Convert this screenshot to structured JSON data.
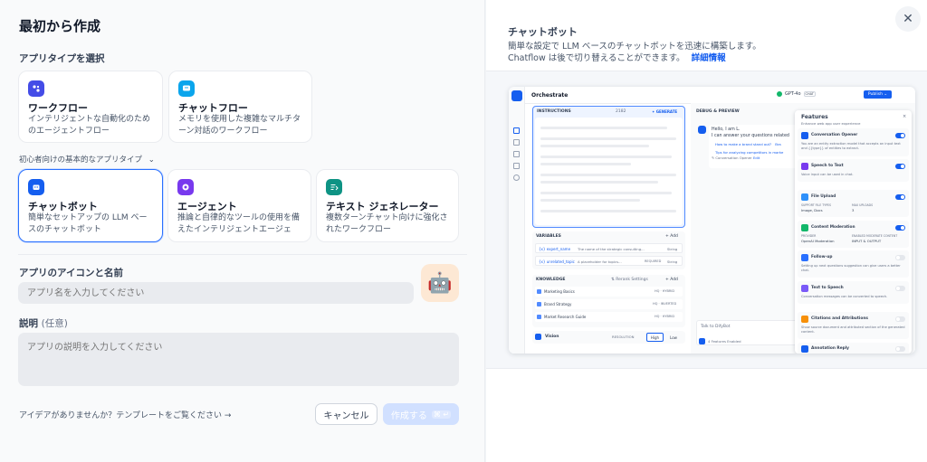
{
  "dialog": {
    "title": "最初から作成",
    "select_type_label": "アプリタイプを選択",
    "beginner_label": "初心者向けの基本的なアプリタイプ",
    "app_types_row1": [
      {
        "name": "ワークフロー",
        "desc": "インテリジェントな自動化のためのエージェントフロー"
      },
      {
        "name": "チャットフロー",
        "desc": "メモリを使用した複雑なマルチターン対話のワークフロー"
      }
    ],
    "app_types_row2": [
      {
        "name": "チャットボット",
        "desc": "簡単なセットアップの LLM ベースのチャットボット"
      },
      {
        "name": "エージェント",
        "desc": "推論と自律的なツールの使用を備えたインテリジェントエージェン…"
      },
      {
        "name": "テキスト ジェネレーター",
        "desc": "複数ターンチャット向けに強化されたワークフロー"
      }
    ],
    "icon_name_label": "アプリのアイコンと名前",
    "name_placeholder": "アプリ名を入力してください",
    "description_label": "説明",
    "description_optional": "(任意)",
    "description_placeholder": "アプリの説明を入力してください",
    "template_link": "アイデアがありませんか？テンプレートをご覧ください →",
    "cancel_label": "キャンセル",
    "create_label": "作成する",
    "create_shortcut": "⌘ ↵",
    "app_icon_emoji": "🤖"
  },
  "preview": {
    "title": "チャットボット",
    "desc_line1": "簡単な設定で LLM ベースのチャットボットを迅速に構築します。",
    "desc_line2": "Chatflow は後で切り替えることができます。",
    "more_link": "詳細情報",
    "close_icon": "close-icon"
  },
  "screenshot": {
    "orchestrate": "Orchestrate",
    "model": "GPT-4o",
    "model_tag": "CHAT",
    "publish": "Publish ⌄",
    "instructions": "INSTRUCTIONS",
    "instructions_count": "2182",
    "generate": "✦ GENERATE",
    "variables": "VARIABLES",
    "add": "+ Add",
    "vars": [
      {
        "key": "{x} expert_name",
        "desc": "The name of the strategic consulting...",
        "type": "String"
      },
      {
        "key": "{x} unrelated_topic",
        "desc": "A placeholder for topics...",
        "type": "String",
        "req": "REQUIRED"
      }
    ],
    "knowledge": "KNOWLEDGE",
    "rerank": "⇅ Rerank Settings",
    "kb": [
      {
        "name": "Marketing Basics",
        "tag": "HQ · HYBRID"
      },
      {
        "name": "Brand Strategy",
        "tag": "HQ · INVERTED"
      },
      {
        "name": "Market Research Guide",
        "tag": "HQ · HYBRID"
      }
    ],
    "vision": "Vision",
    "resolution": "RESOLUTION",
    "high": "High",
    "low": "Low",
    "debug": "DEBUG & PREVIEW",
    "hello": "Hello, I am L.",
    "answer": "I can answer your questions related",
    "sugg1": "How to make a brand stand out?",
    "sugg1b": "Bra",
    "sugg2": "Tips for analyzing competitors in marke",
    "opener": "✎ Conversation Opener",
    "edit": "Edit",
    "talk": "Talk to DifyBot",
    "features_enabled": "4 Features Enabled",
    "features": "Features",
    "features_sub": "Enhance web app user experience",
    "feature_list": [
      {
        "name": "Conversation Opener",
        "desc": "You are an entity extraction model that accepts an input text and {{type}} of entities to extract.",
        "on": true,
        "color": "#155eef"
      },
      {
        "name": "Speech to Text",
        "desc": "Voice input can be used in chat.",
        "on": true,
        "color": "#7839ee"
      },
      {
        "name": "File Upload",
        "desc": "",
        "on": true,
        "color": "#2e90fa"
      },
      {
        "name": "Content Moderation",
        "desc": "",
        "on": true,
        "color": "#12b76a"
      },
      {
        "name": "Follow-up",
        "desc": "Setting up next questions suggestion can give users a better chat.",
        "on": false,
        "color": "#2970ff"
      },
      {
        "name": "Text to Speech",
        "desc": "Conversation messages can be converted to speech.",
        "on": false,
        "color": "#7a5af8"
      },
      {
        "name": "Citations and Attributions",
        "desc": "Show source document and attributed section of the generated content.",
        "on": false,
        "color": "#f79009"
      },
      {
        "name": "Annotation Reply",
        "desc": "",
        "on": false,
        "color": "#155eef"
      }
    ],
    "file_types_label": "SUPPORT FILE TYPES",
    "file_types": "Image, Docs",
    "max_uploads_label": "MAX UPLOADS",
    "max_uploads": "3",
    "provider_label": "PROVIDER",
    "provider": "OpenAI Moderation",
    "enabled_label": "ENABLED MODERATE CONTENT",
    "enabled": "INPUT & OUTPUT"
  },
  "colors": {
    "accent": "#155eef",
    "selected_border": "#2970ff",
    "create_disabled": "#b2ccff"
  }
}
